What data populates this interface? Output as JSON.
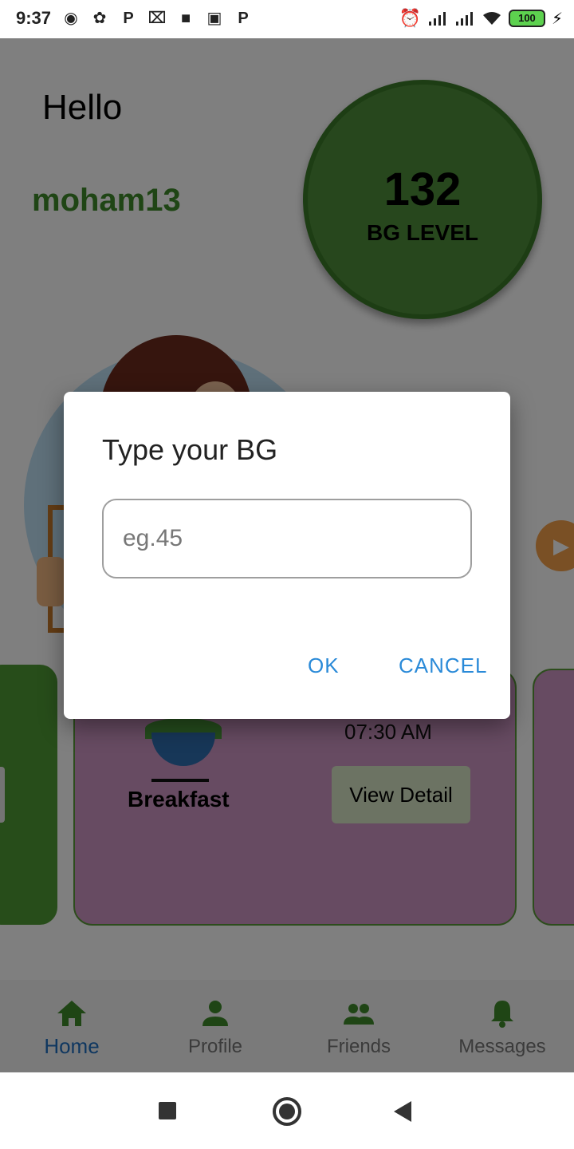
{
  "status_bar": {
    "time": "9:37",
    "battery": "100",
    "left_icons": [
      "notification-icon",
      "pinwheel-icon",
      "p-icon",
      "x-icon",
      "video-icon",
      "robot-icon",
      "p-icon"
    ],
    "right_icons": [
      "alarm-icon",
      "signal-icon",
      "signal-icon",
      "wifi-icon",
      "battery-icon",
      "charging-icon"
    ]
  },
  "home": {
    "greeting": "Hello",
    "username": "moham13",
    "bg_value": "132",
    "bg_label": "BG LEVEL",
    "meal_card": {
      "name": "Breakfast",
      "time": "07:30 AM",
      "button_label": "View Detail"
    },
    "colors": {
      "accent_green": "#4f8e3a",
      "meal_card": "#cf96c4",
      "link_blue": "#2a8ad8"
    }
  },
  "bottom_nav": {
    "items": [
      {
        "label": "Home",
        "icon": "home-icon",
        "active": true
      },
      {
        "label": "Profile",
        "icon": "person-icon",
        "active": false
      },
      {
        "label": "Friends",
        "icon": "people-icon",
        "active": false
      },
      {
        "label": "Messages",
        "icon": "bell-icon",
        "active": false
      }
    ]
  },
  "dialog": {
    "title": "Type your BG",
    "input_value": "",
    "input_placeholder": "eg.45",
    "ok_label": "OK",
    "cancel_label": "CANCEL"
  }
}
